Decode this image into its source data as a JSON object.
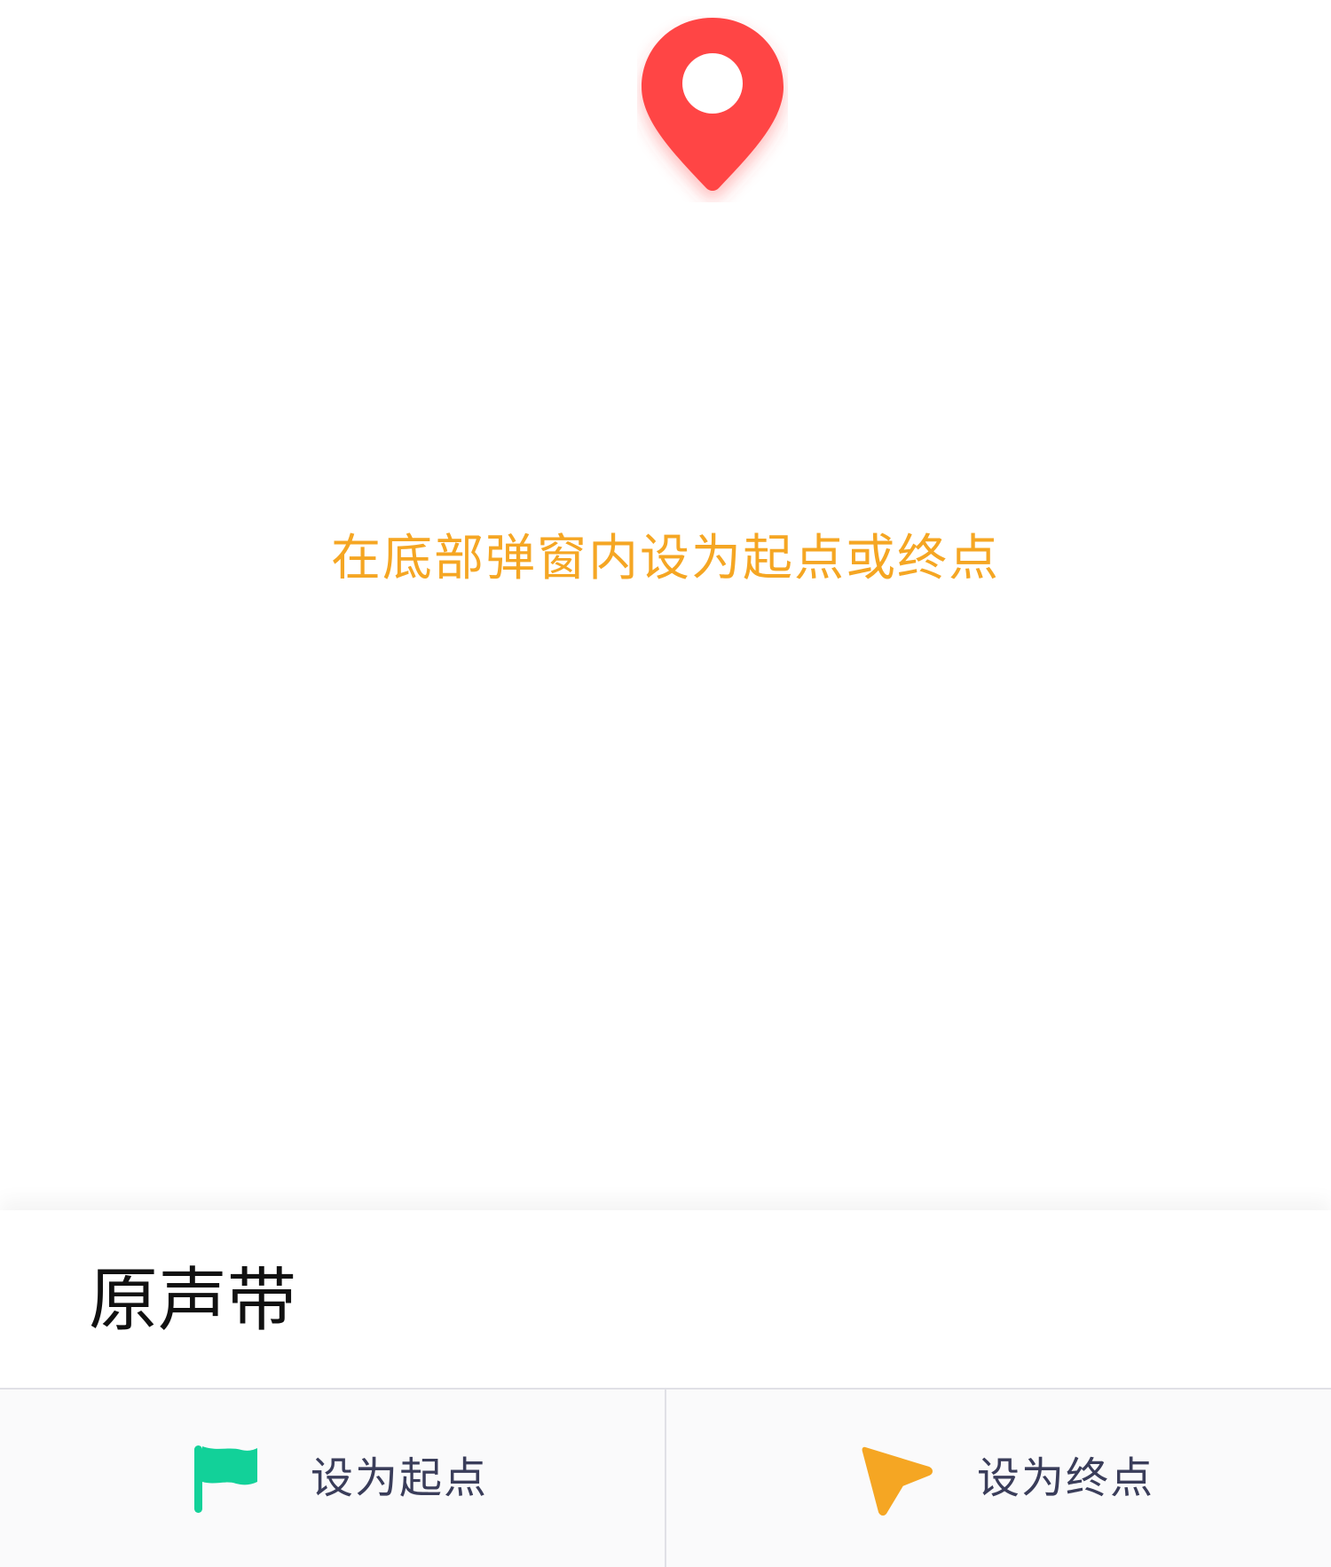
{
  "map": {
    "pin_icon": "location-pin-icon",
    "pin_color": "#ff4545",
    "hint_text": "在底部弹窗内设为起点或终点",
    "hint_color": "#f5a623"
  },
  "sheet": {
    "place_name": "原声带",
    "actions": [
      {
        "label": "设为起点",
        "icon": "green-flag-icon",
        "icon_color": "#12d199"
      },
      {
        "label": "设为终点",
        "icon": "orange-arrow-icon",
        "icon_color": "#f5a623"
      }
    ]
  }
}
